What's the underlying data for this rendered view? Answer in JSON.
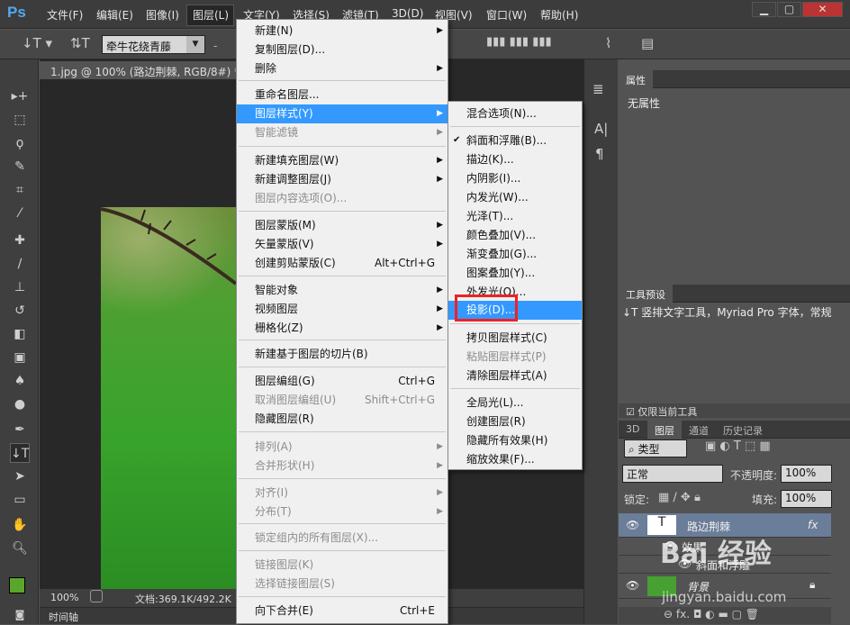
{
  "app": {
    "logo": "Ps"
  },
  "menubar": {
    "items": [
      "文件(F)",
      "编辑(E)",
      "图像(I)",
      "图层(L)",
      "文字(Y)",
      "选择(S)",
      "滤镜(T)",
      "3D(D)",
      "视图(V)",
      "窗口(W)",
      "帮助(H)"
    ],
    "active": "图层(L)",
    "win_min": "▁",
    "win_max": "▢",
    "win_close": "✕"
  },
  "optbar": {
    "font_family": "牵牛花绕青藤",
    "dash": "-"
  },
  "document": {
    "tab_title": "1.jpg @ 100% (路边荆棘, RGB/8#) *",
    "tab_close": "×"
  },
  "status": {
    "zoom": "100%",
    "doc_info": "文档:369.1K/492.2K"
  },
  "timeline": {
    "label": "时间轴"
  },
  "layer_menu": {
    "items": [
      {
        "label": "新建(N)",
        "sc": "",
        "sub": true,
        "dis": false
      },
      {
        "label": "复制图层(D)...",
        "sc": "",
        "sub": false,
        "dis": false
      },
      {
        "label": "删除",
        "sc": "",
        "sub": true,
        "dis": false
      },
      {
        "label": "重命名图层...",
        "sc": "",
        "sub": false,
        "dis": false
      },
      {
        "label": "图层样式(Y)",
        "sc": "",
        "sub": true,
        "dis": false,
        "hl": true
      },
      {
        "label": "智能滤镜",
        "sc": "",
        "sub": true,
        "dis": true
      },
      {
        "label": "新建填充图层(W)",
        "sc": "",
        "sub": true,
        "dis": false
      },
      {
        "label": "新建调整图层(J)",
        "sc": "",
        "sub": true,
        "dis": false
      },
      {
        "label": "图层内容选项(O)...",
        "sc": "",
        "sub": false,
        "dis": true
      },
      {
        "label": "图层蒙版(M)",
        "sc": "",
        "sub": true,
        "dis": false
      },
      {
        "label": "矢量蒙版(V)",
        "sc": "",
        "sub": true,
        "dis": false
      },
      {
        "label": "创建剪贴蒙版(C)",
        "sc": "Alt+Ctrl+G",
        "sub": false,
        "dis": false
      },
      {
        "label": "智能对象",
        "sc": "",
        "sub": true,
        "dis": false
      },
      {
        "label": "视频图层",
        "sc": "",
        "sub": true,
        "dis": false
      },
      {
        "label": "栅格化(Z)",
        "sc": "",
        "sub": true,
        "dis": false
      },
      {
        "label": "新建基于图层的切片(B)",
        "sc": "",
        "sub": false,
        "dis": false
      },
      {
        "label": "图层编组(G)",
        "sc": "Ctrl+G",
        "sub": false,
        "dis": false
      },
      {
        "label": "取消图层编组(U)",
        "sc": "Shift+Ctrl+G",
        "sub": false,
        "dis": true
      },
      {
        "label": "隐藏图层(R)",
        "sc": "",
        "sub": false,
        "dis": false
      },
      {
        "label": "排列(A)",
        "sc": "",
        "sub": true,
        "dis": true
      },
      {
        "label": "合并形状(H)",
        "sc": "",
        "sub": true,
        "dis": true
      },
      {
        "label": "对齐(I)",
        "sc": "",
        "sub": true,
        "dis": true
      },
      {
        "label": "分布(T)",
        "sc": "",
        "sub": true,
        "dis": true
      },
      {
        "label": "锁定组内的所有图层(X)...",
        "sc": "",
        "sub": false,
        "dis": true
      },
      {
        "label": "链接图层(K)",
        "sc": "",
        "sub": false,
        "dis": true
      },
      {
        "label": "选择链接图层(S)",
        "sc": "",
        "sub": false,
        "dis": true
      },
      {
        "label": "向下合并(E)",
        "sc": "Ctrl+E",
        "sub": false,
        "dis": false
      }
    ]
  },
  "style_menu": {
    "items": [
      {
        "label": "混合选项(N)...",
        "dis": false
      },
      {
        "label": "斜面和浮雕(B)...",
        "dis": false,
        "check": true
      },
      {
        "label": "描边(K)...",
        "dis": false
      },
      {
        "label": "内阴影(I)...",
        "dis": false
      },
      {
        "label": "内发光(W)...",
        "dis": false
      },
      {
        "label": "光泽(T)...",
        "dis": false
      },
      {
        "label": "颜色叠加(V)...",
        "dis": false
      },
      {
        "label": "渐变叠加(G)...",
        "dis": false
      },
      {
        "label": "图案叠加(Y)...",
        "dis": false
      },
      {
        "label": "外发光(O)...",
        "dis": false
      },
      {
        "label": "投影(D)...",
        "dis": false,
        "hl": true
      },
      {
        "label": "拷贝图层样式(C)",
        "dis": false
      },
      {
        "label": "粘贴图层样式(P)",
        "dis": true
      },
      {
        "label": "清除图层样式(A)",
        "dis": false
      },
      {
        "label": "全局光(L)...",
        "dis": false
      },
      {
        "label": "创建图层(R)",
        "dis": false
      },
      {
        "label": "隐藏所有效果(H)",
        "dis": false
      },
      {
        "label": "缩放效果(F)...",
        "dis": false
      }
    ]
  },
  "properties": {
    "title": "属性",
    "content": "无属性"
  },
  "tool_presets": {
    "title": "工具预设",
    "entry": "竖排文字工具，Myriad Pro 字体，常规",
    "current_only": "仅限当前工具"
  },
  "layers_panel": {
    "tabs": [
      "3D",
      "图层",
      "通道",
      "历史记录"
    ],
    "kind": "类型",
    "blend": "正常",
    "opacity_label": "不透明度:",
    "opacity": "100%",
    "lock_label": "锁定:",
    "fill_label": "填充:",
    "fill": "100%",
    "layers": [
      {
        "name": "路边荆棘",
        "fx": "fx"
      },
      {
        "name": "效果"
      },
      {
        "name": "斜面和浮雕"
      },
      {
        "name": "背景"
      }
    ]
  },
  "watermark": {
    "text": "Bai 经验",
    "url": "jingyan.baidu.com"
  }
}
